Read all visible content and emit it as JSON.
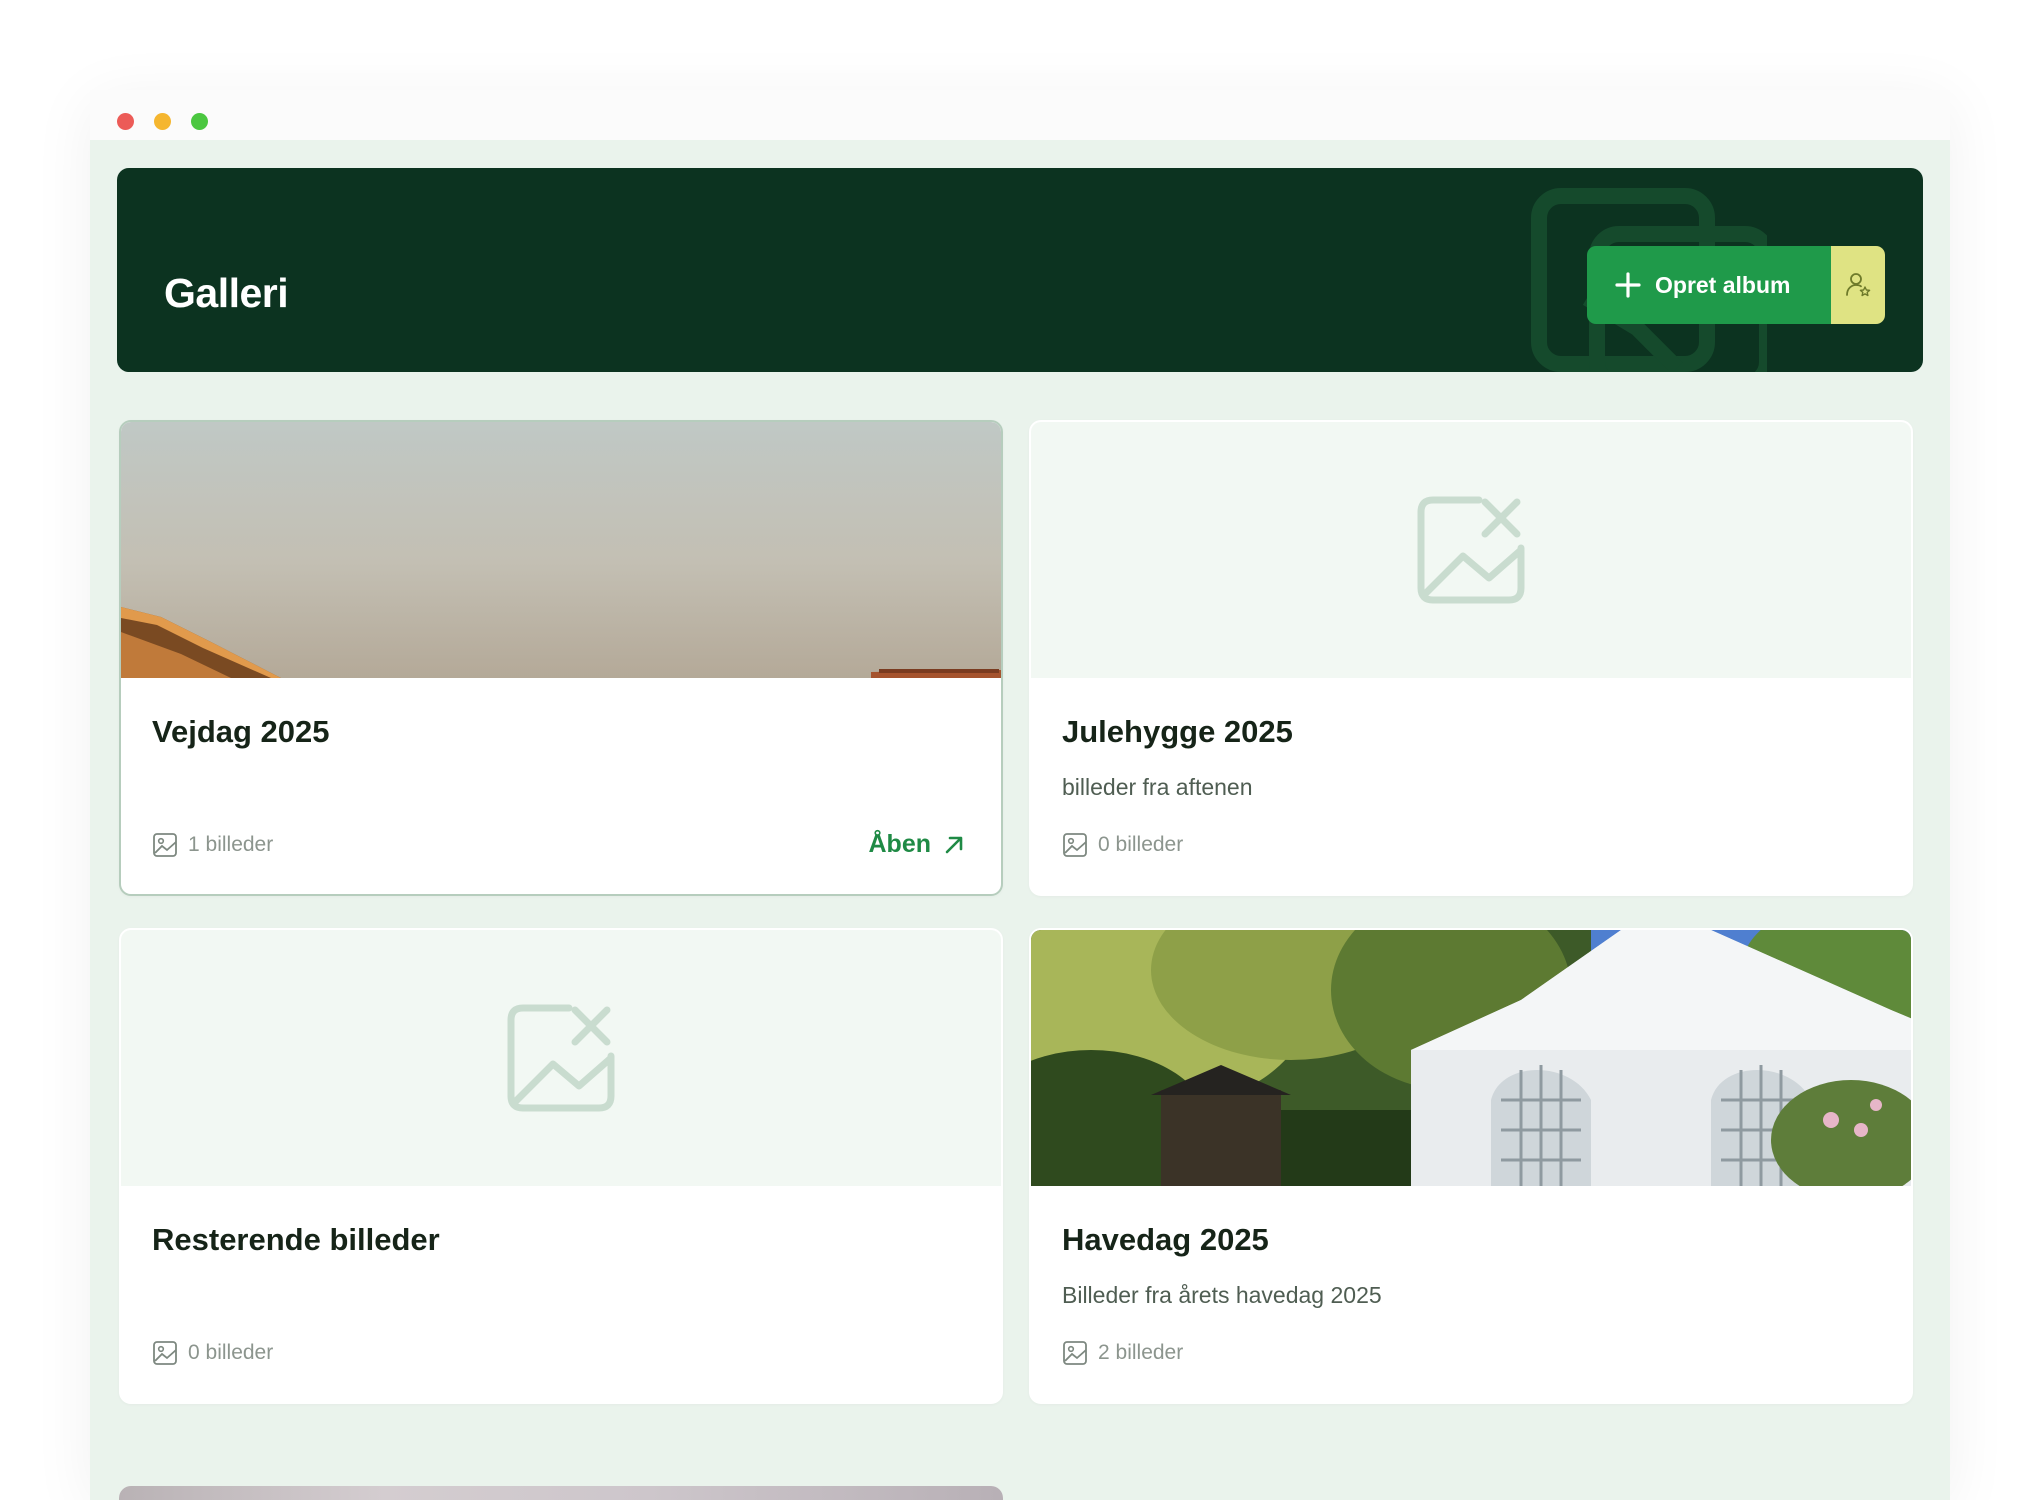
{
  "header": {
    "title": "Galleri",
    "create_label": "Opret album"
  },
  "albums": [
    {
      "title": "Vejdag 2025",
      "description": "",
      "count": "1 billeder",
      "open_label": "Åben",
      "has_image": true
    },
    {
      "title": "Julehygge 2025",
      "description": "billeder fra aftenen",
      "count": "0 billeder",
      "has_image": false
    },
    {
      "title": "Resterende billeder",
      "description": "",
      "count": "0 billeder",
      "has_image": false
    },
    {
      "title": "Havedag 2025",
      "description": "Billeder fra årets havedag 2025",
      "count": "2 billeder",
      "has_image": true
    }
  ],
  "colors": {
    "header_bg": "#0c3320",
    "primary": "#1f9a4a",
    "accent": "#dfe383",
    "app_bg": "#eaf3ec"
  }
}
